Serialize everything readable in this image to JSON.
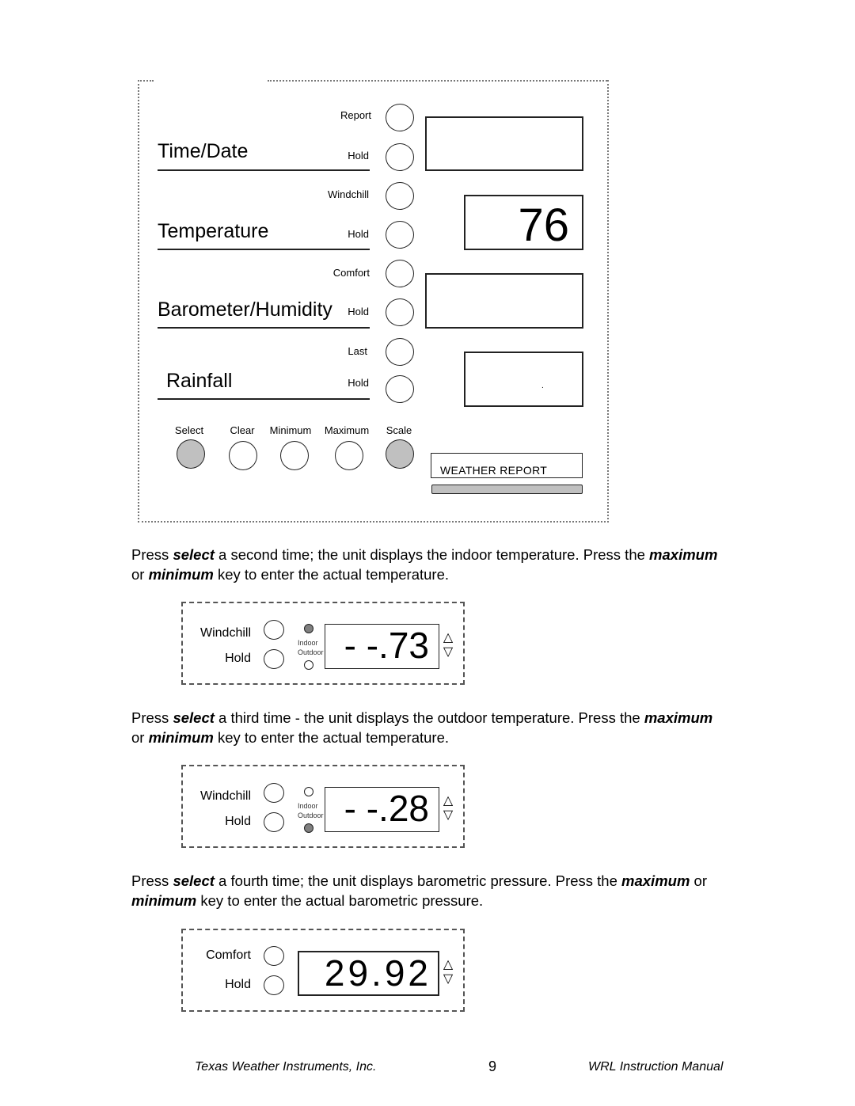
{
  "panel": {
    "sections": [
      {
        "title": "Time/Date",
        "top_label": "Report",
        "hold_label": "Hold"
      },
      {
        "title": "Temperature",
        "top_label": "Windchill",
        "hold_label": "Hold"
      },
      {
        "title": "Barometer/Humidity",
        "top_label": "Comfort",
        "hold_label": "Hold"
      },
      {
        "title": "Rainfall",
        "top_label": "Last",
        "hold_label": "Hold"
      }
    ],
    "displays": {
      "time_date": "",
      "temperature": "76",
      "barometer_humidity": "",
      "rainfall": "."
    },
    "bottom_buttons": [
      {
        "label": "Select",
        "active": true
      },
      {
        "label": "Clear",
        "active": false
      },
      {
        "label": "Minimum",
        "active": false
      },
      {
        "label": "Maximum",
        "active": false
      },
      {
        "label": "Scale",
        "active": true
      }
    ],
    "weather_report_label": "WEATHER REPORT"
  },
  "paragraphs": [
    {
      "pre": "Press ",
      "k1": "select",
      "mid": " a second time; the unit displays the indoor temperature. Press the ",
      "k2": "maximum",
      "line2_pre": "or ",
      "k3": "minimum",
      "post": " key to enter the actual temperature."
    },
    {
      "pre": "Press ",
      "k1": "select",
      "mid": " a third time - the unit displays the outdoor temperature. Press the ",
      "k2": "maximum",
      "line2_pre": "or ",
      "k3": "minimum",
      "post": " key to enter the actual temperature."
    },
    {
      "pre": "Press ",
      "k1": "select",
      "mid": " a fourth time; the unit displays barometric pressure. Press the ",
      "k2": "maximum",
      "mid2": " or",
      "k3": "minimum",
      "post": " key to enter the actual barometric pressure."
    }
  ],
  "mini_panels": [
    {
      "top_label": "Windchill",
      "hold_label": "Hold",
      "indoor_label": "Indoor",
      "outdoor_label": "Outdoor",
      "indoor_on": true,
      "outdoor_on": false,
      "value": "- -.73",
      "up_arrow": "△",
      "down_arrow": "▽"
    },
    {
      "top_label": "Windchill",
      "hold_label": "Hold",
      "indoor_label": "Indoor",
      "outdoor_label": "Outdoor",
      "indoor_on": false,
      "outdoor_on": true,
      "value": "- -.28",
      "up_arrow": "△",
      "down_arrow": "▽"
    },
    {
      "top_label": "Comfort",
      "hold_label": "Hold",
      "value": "29.92",
      "up_arrow": "△",
      "down_arrow": "▽"
    }
  ],
  "footer": {
    "left": "Texas Weather Instruments, Inc.",
    "page": "9",
    "right": "WRL Instruction Manual"
  }
}
